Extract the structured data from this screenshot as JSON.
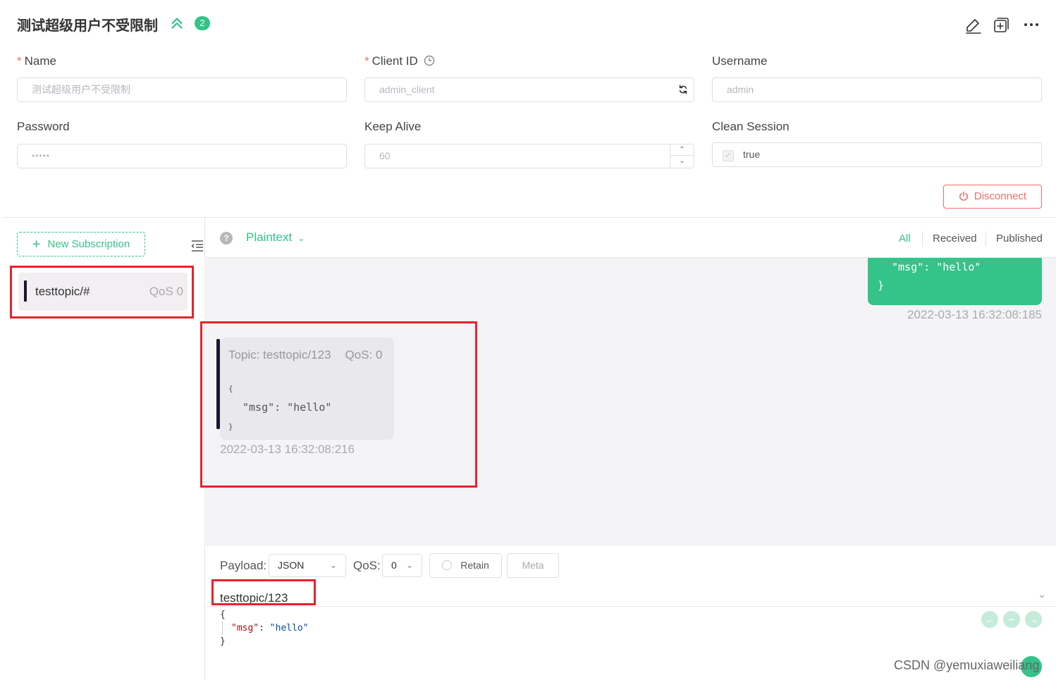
{
  "header": {
    "title": "测试超级用户不受限制",
    "badge_count": "2"
  },
  "form": {
    "name": {
      "label": "Name",
      "value": "测试超级用户不受限制"
    },
    "client_id": {
      "label": "Client ID",
      "value": "admin_client"
    },
    "username": {
      "label": "Username",
      "value": "admin"
    },
    "password": {
      "label": "Password",
      "value": "•••••"
    },
    "keep_alive": {
      "label": "Keep Alive",
      "value": "60"
    },
    "clean_session": {
      "label": "Clean Session",
      "value": "true"
    },
    "disconnect_label": "Disconnect"
  },
  "subscriptions": {
    "new_label": "New Subscription",
    "items": [
      {
        "topic": "testtopic/#",
        "qos": "QoS 0"
      }
    ]
  },
  "messages": {
    "format": "Plaintext",
    "filters": [
      "All",
      "Received",
      "Published"
    ],
    "published": {
      "line1": "\"msg\": \"hello\"",
      "line2": "}",
      "time": "2022-03-13 16:32:08:185"
    },
    "received": {
      "topic": "Topic: testtopic/123",
      "qos": "QoS: 0",
      "open": "{",
      "line": "\"msg\": \"hello\"",
      "close": "}",
      "time": "2022-03-13 16:32:08:216"
    }
  },
  "publish": {
    "payload_label": "Payload:",
    "payload_type": "JSON",
    "qos_label": "QoS:",
    "qos_value": "0",
    "retain_label": "Retain",
    "meta_label": "Meta",
    "topic": "testtopic/123",
    "payload_open": "{",
    "payload_key": "\"msg\"",
    "payload_colon": ": ",
    "payload_value": "\"hello\"",
    "payload_close": "}"
  },
  "watermark": "CSDN @yemuxiaweiliang",
  "colors": {
    "accent": "#34c388",
    "danger": "#f56c6c",
    "annotation": "#e8222d"
  }
}
